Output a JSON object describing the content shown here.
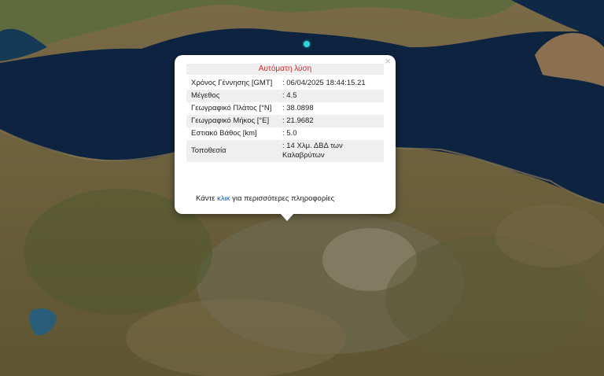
{
  "popup": {
    "title": "Αυτόματη λύση",
    "close_symbol": "×",
    "rows": [
      {
        "label": "Χρόνος Γέννησης [GMT]",
        "value": ": 06/04/2025 18:44:15.21"
      },
      {
        "label": "Μέγεθος",
        "value": ": 4.5"
      },
      {
        "label": "Γεωγραφικό Πλάτος [°N]",
        "value": ": 38.0898"
      },
      {
        "label": "Γεωγραφικό Μήκος [°E]",
        "value": ": 21.9682"
      },
      {
        "label": "Εστιακό Βάθος [km]",
        "value": ": 5.0"
      },
      {
        "label": "Τοποθεσία",
        "value": ": 14 Χλμ. ΔΒΔ των Καλαβρύτων"
      }
    ],
    "more": {
      "prefix": "Κάντε ",
      "link": "κλικ",
      "suffix": " για περισσότερες πληροφορίες"
    }
  },
  "colors": {
    "title": "#d22a2a",
    "link": "#1a5fc4",
    "marker": "#2fd3d8",
    "sea": "#0d2340"
  }
}
